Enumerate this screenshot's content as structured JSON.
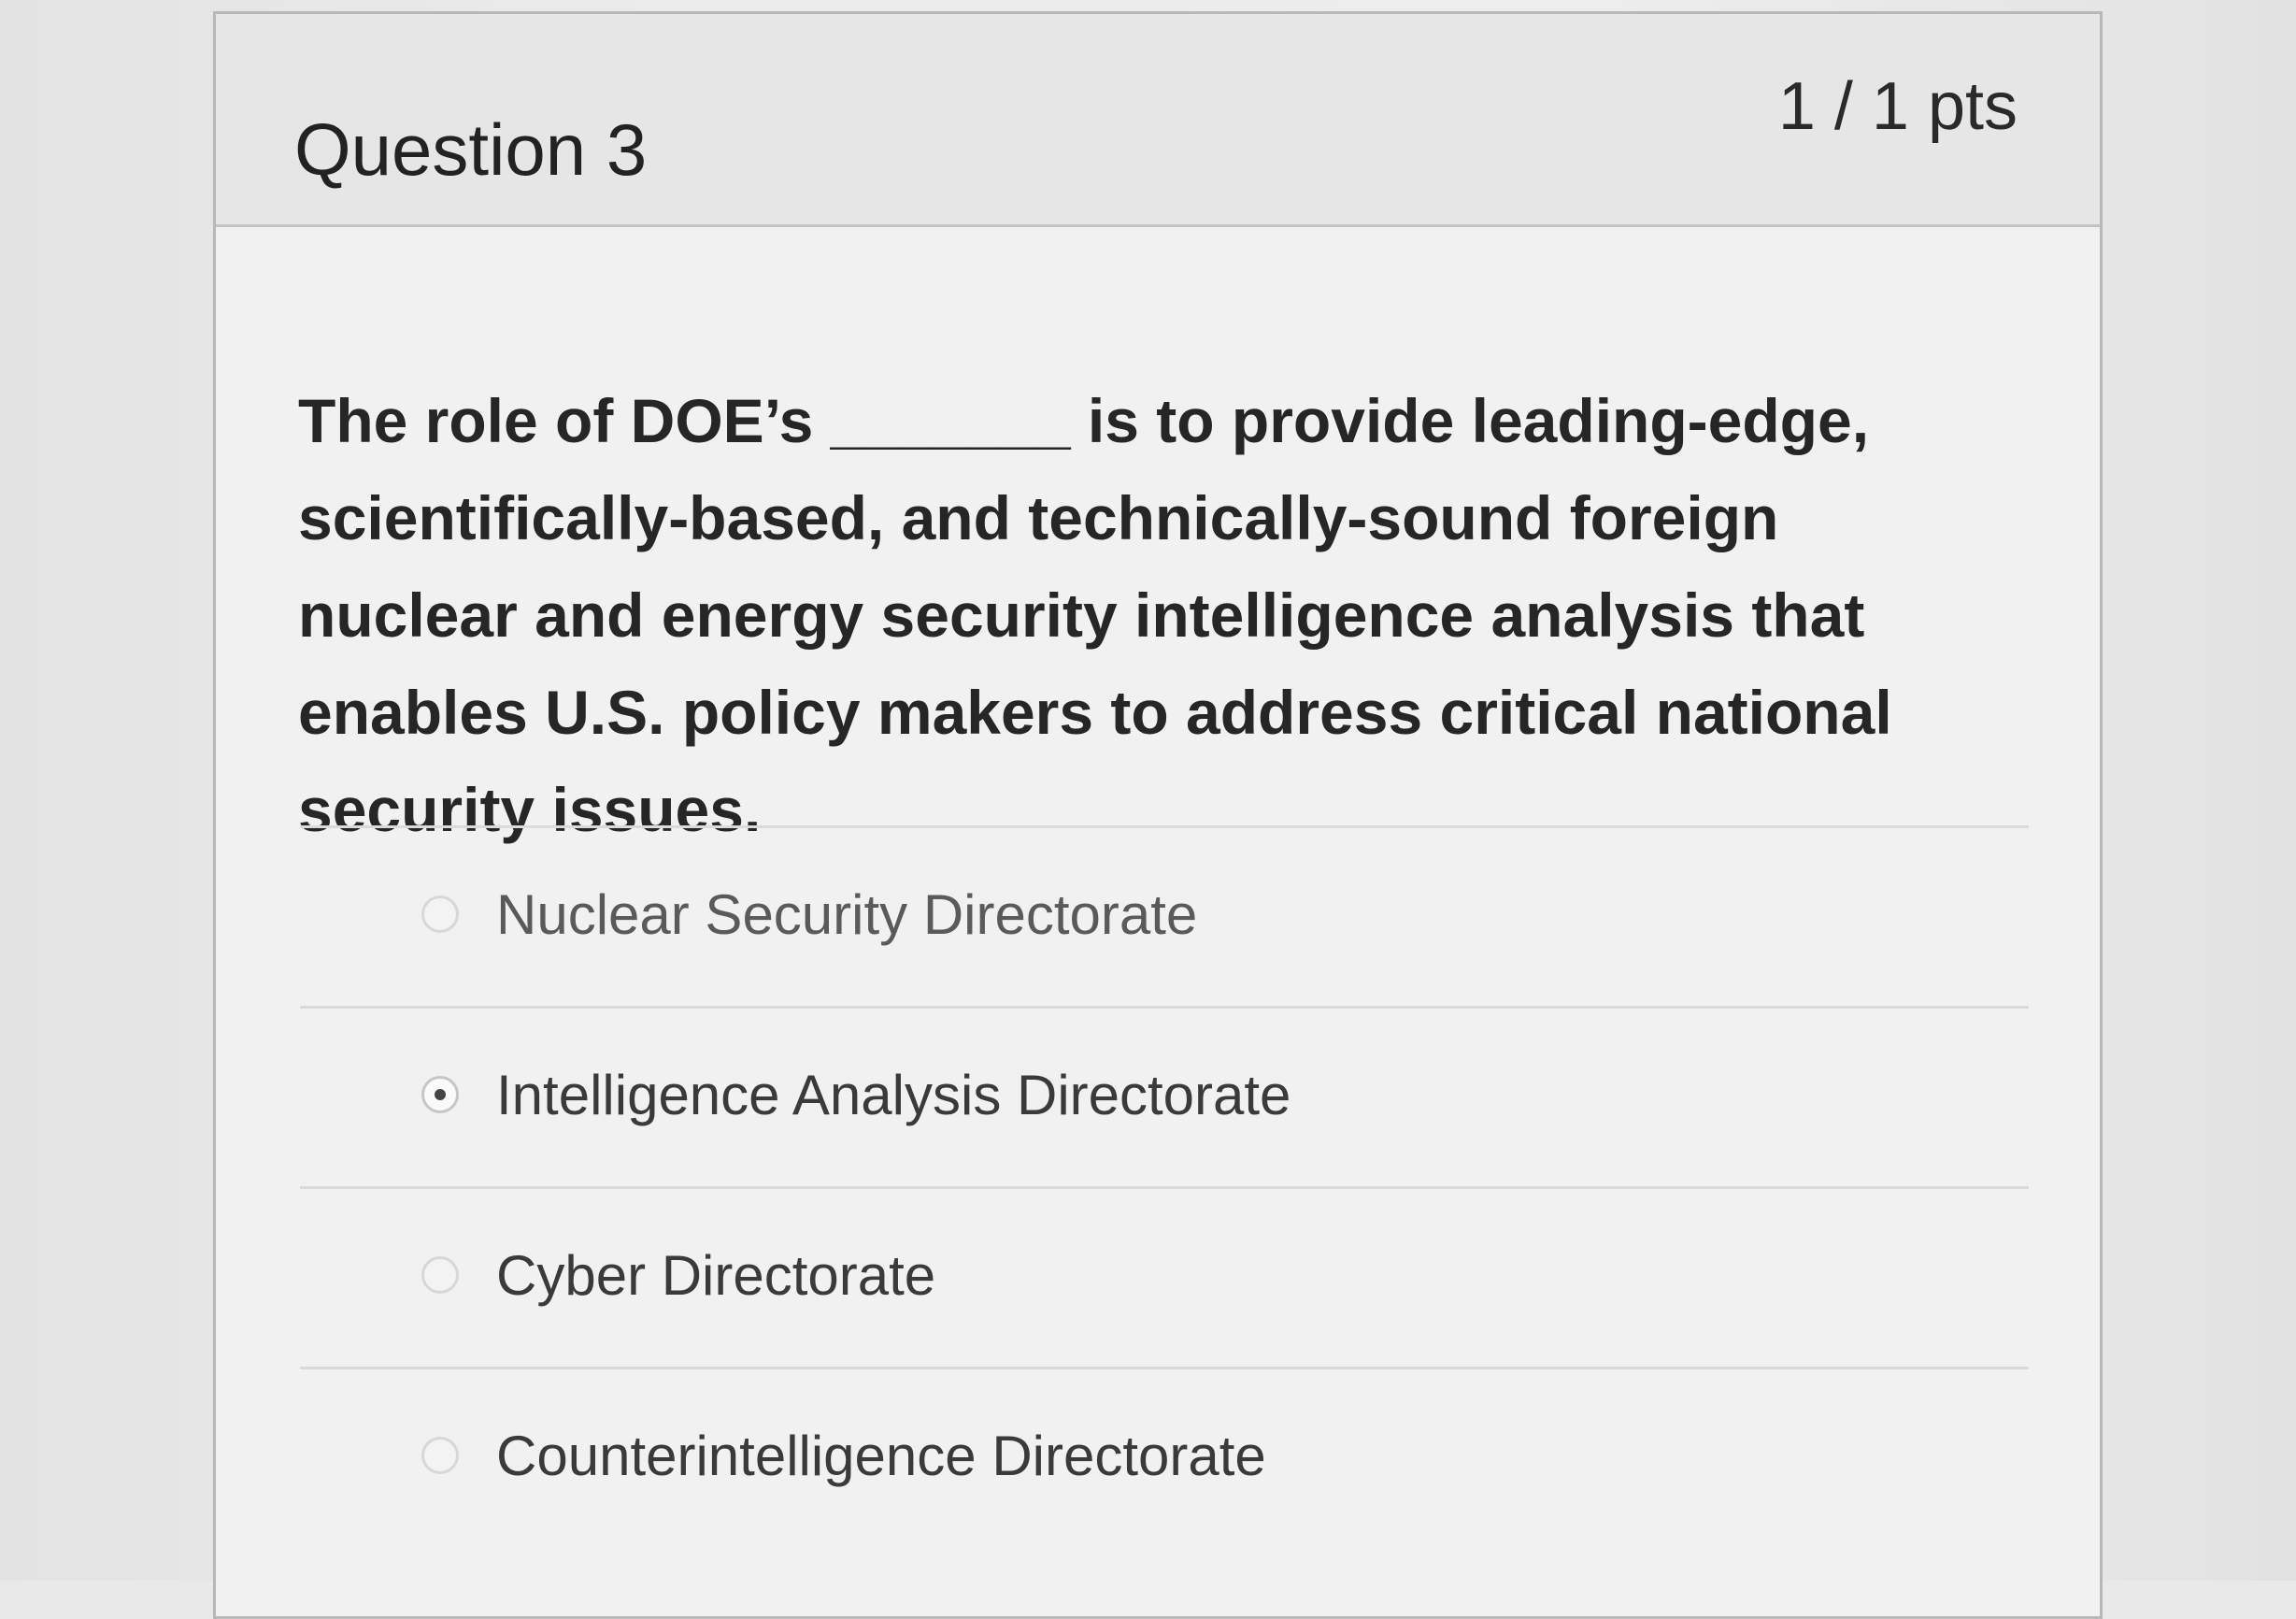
{
  "question": {
    "title": "Question 3",
    "points": "1 / 1 pts",
    "text": "The role of DOE’s _______ is to provide leading-edge, scientifically-based, and technically-sound foreign nuclear and energy security intelligence analysis that enables U.S. policy makers to address critical national security issues."
  },
  "answers": [
    {
      "label": "Nuclear Security Directorate",
      "selected": false
    },
    {
      "label": "Intelligence Analysis Directorate",
      "selected": true
    },
    {
      "label": "Cyber Directorate",
      "selected": false
    },
    {
      "label": "Counterintelligence Directorate",
      "selected": false
    }
  ]
}
